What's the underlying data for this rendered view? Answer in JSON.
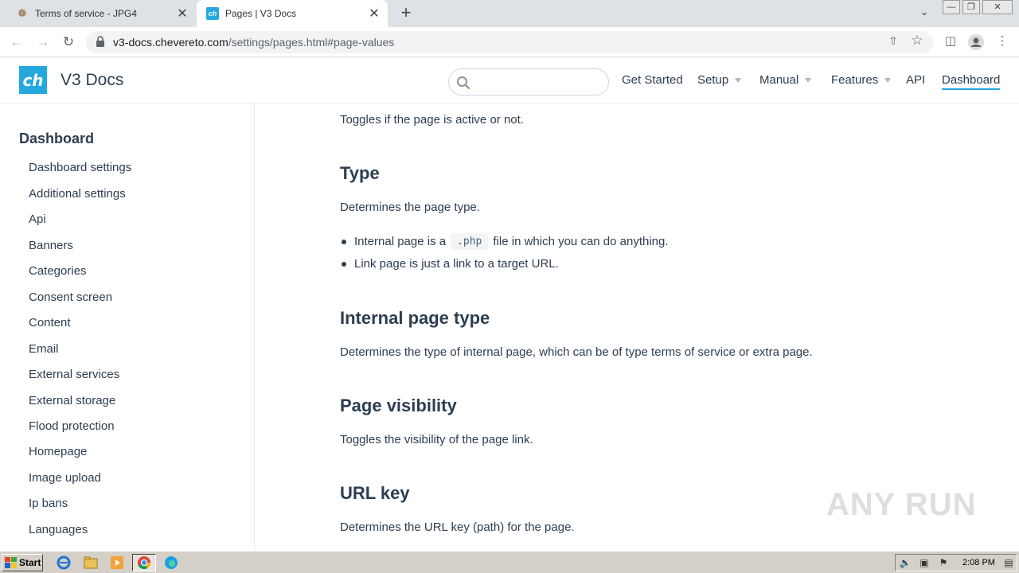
{
  "browser": {
    "tabs": [
      {
        "title": "Terms of service - JPG4",
        "favicon": "jpg-icon",
        "active": false
      },
      {
        "title": "Pages | V3 Docs",
        "favicon": "ch",
        "active": true
      }
    ],
    "new_tab": "+",
    "url_host": "v3-docs.chevereto.com",
    "url_path": "/settings/pages.html#page-values"
  },
  "site": {
    "logo_text": "ch",
    "name": "V3 Docs",
    "search": {
      "placeholder": ""
    },
    "nav": [
      {
        "label": "Get Started",
        "dropdown": false
      },
      {
        "label": "Setup",
        "dropdown": true
      },
      {
        "label": "Manual",
        "dropdown": true
      },
      {
        "label": "Features",
        "dropdown": true
      },
      {
        "label": "API",
        "dropdown": false
      },
      {
        "label": "Dashboard",
        "dropdown": false,
        "current": true
      }
    ],
    "accent_color": "#23a8e0"
  },
  "sidebar": {
    "heading": "Dashboard",
    "items": [
      "Dashboard settings",
      "Additional settings",
      "Api",
      "Banners",
      "Categories",
      "Consent screen",
      "Content",
      "Email",
      "External services",
      "External storage",
      "Flood protection",
      "Homepage",
      "Image upload",
      "Ip bans",
      "Languages"
    ]
  },
  "content": {
    "intro": "Toggles if the page is active or not.",
    "sections": [
      {
        "title": "Type",
        "text": "Determines the page type.",
        "bullets": {
          "b1_before": "Internal page is a",
          "b1_code": ".php",
          "b1_after": "file in which you can do anything.",
          "b2": "Link page is just a link to a target URL."
        }
      },
      {
        "title": "Internal page type",
        "text": "Determines the type of internal page, which can be of type terms of service or extra page."
      },
      {
        "title": "Page visibility",
        "text": "Toggles the visibility of the page link."
      },
      {
        "title": "URL key",
        "text": "Determines the URL key (path) for the page."
      }
    ]
  },
  "watermark": "ANY RUN",
  "taskbar": {
    "start_label": "Start",
    "clock": "2:08 PM"
  }
}
